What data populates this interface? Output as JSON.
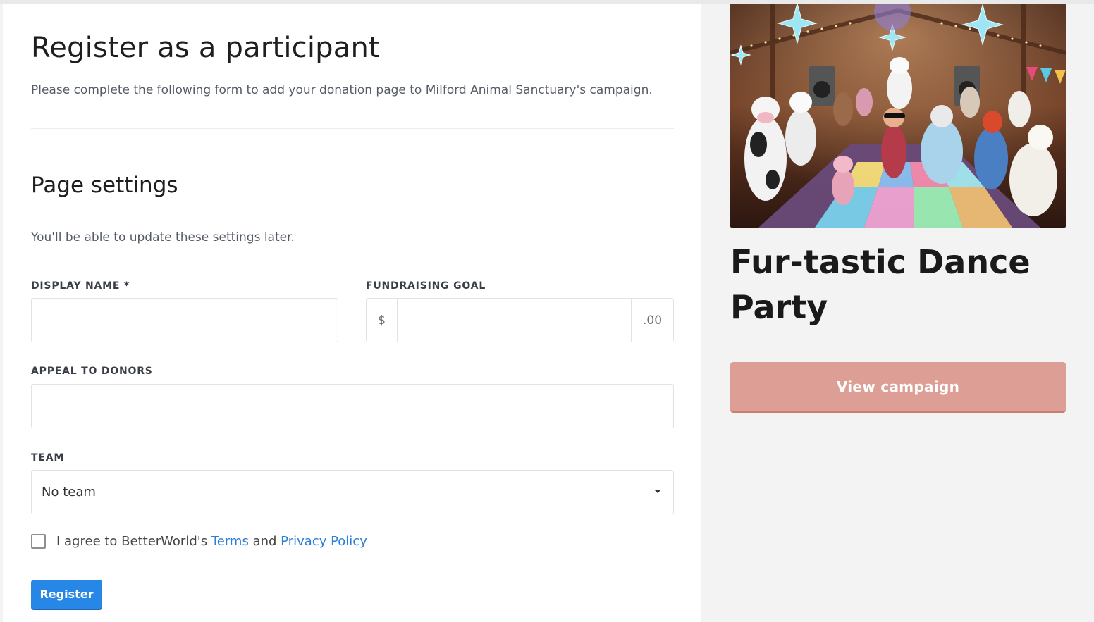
{
  "form": {
    "title": "Register as a participant",
    "intro": "Please complete the following form to add your donation page to Milford Animal Sanctuary's campaign.",
    "section_title": "Page settings",
    "section_note": "You'll be able to update these settings later.",
    "display_name": {
      "label": "DISPLAY NAME *",
      "value": ""
    },
    "fundraising_goal": {
      "label": "FUNDRAISING GOAL",
      "prefix": "$",
      "suffix": ".00",
      "value": ""
    },
    "appeal": {
      "label": "APPEAL TO DONORS",
      "value": ""
    },
    "team": {
      "label": "TEAM",
      "selected": "No team"
    },
    "agree": {
      "text_before": "I agree to BetterWorld's",
      "terms_link": "Terms",
      "and": "and",
      "privacy_link": "Privacy Policy",
      "checked": false
    },
    "register_label": "Register"
  },
  "campaign": {
    "title": "Fur-tastic Dance Party",
    "view_label": "View campaign",
    "image_alt": "dance-party-illustration",
    "button_color": "#dd9f95"
  },
  "theme": {
    "primary": "#2687e6",
    "link": "#2b7fd6"
  }
}
